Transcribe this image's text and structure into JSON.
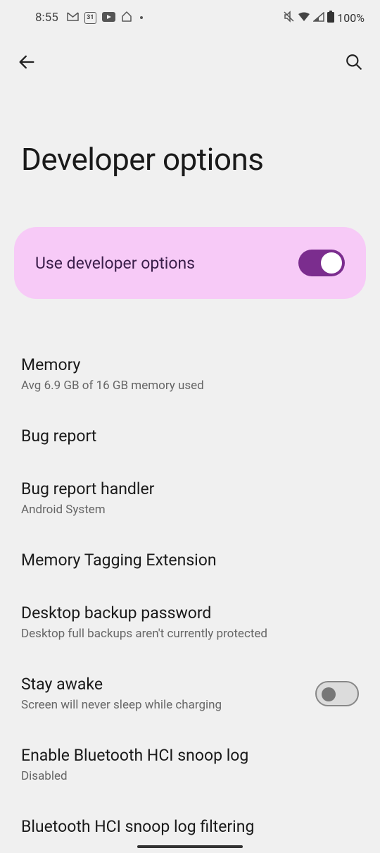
{
  "status": {
    "time": "8:55",
    "battery": "100%"
  },
  "page": {
    "title": "Developer options"
  },
  "masterToggle": {
    "label": "Use developer options",
    "enabled": true
  },
  "settings": [
    {
      "title": "Memory",
      "subtitle": "Avg 6.9 GB of 16 GB memory used",
      "hasSwitch": false
    },
    {
      "title": "Bug report",
      "subtitle": "",
      "hasSwitch": false
    },
    {
      "title": "Bug report handler",
      "subtitle": "Android System",
      "hasSwitch": false
    },
    {
      "title": "Memory Tagging Extension",
      "subtitle": "",
      "hasSwitch": false
    },
    {
      "title": "Desktop backup password",
      "subtitle": "Desktop full backups aren't currently protected",
      "hasSwitch": false
    },
    {
      "title": "Stay awake",
      "subtitle": "Screen will never sleep while charging",
      "hasSwitch": true,
      "switchOn": false
    },
    {
      "title": "Enable Bluetooth HCI snoop log",
      "subtitle": "Disabled",
      "hasSwitch": false
    },
    {
      "title": "Bluetooth HCI snoop log filtering",
      "subtitle": "",
      "hasSwitch": false
    }
  ]
}
